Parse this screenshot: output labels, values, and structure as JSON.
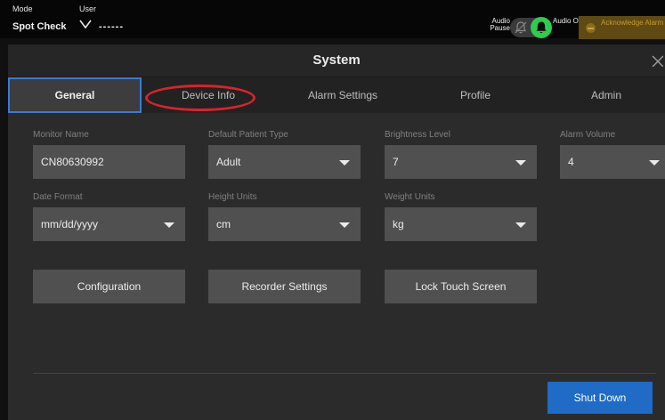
{
  "status_bar": {
    "mode_label": "Mode",
    "mode_value": "Spot Check",
    "user_label": "User",
    "user_value": "------",
    "audio_pause_label": "Audio Pause",
    "audio_on_label": "Audio On",
    "acknowledge_alarm_label": "Acknowledge Alarm",
    "audio_on_color": "#2ecc4f"
  },
  "dialog": {
    "title": "System",
    "tabs": [
      {
        "label": "General",
        "active": true
      },
      {
        "label": "Device Info",
        "active": false
      },
      {
        "label": "Alarm Settings",
        "active": false
      },
      {
        "label": "Profile",
        "active": false
      },
      {
        "label": "Admin",
        "active": false
      }
    ],
    "fields": {
      "monitor_name": {
        "label": "Monitor Name",
        "value": "CN80630992"
      },
      "default_patient_type": {
        "label": "Default Patient Type",
        "value": "Adult"
      },
      "brightness_level": {
        "label": "Brightness Level",
        "value": "7"
      },
      "alarm_volume": {
        "label": "Alarm Volume",
        "value": "4"
      },
      "date_format": {
        "label": "Date Format",
        "value": "mm/dd/yyyy"
      },
      "height_units": {
        "label": "Height Units",
        "value": "cm"
      },
      "weight_units": {
        "label": "Weight Units",
        "value": "kg"
      }
    },
    "buttons": {
      "configuration": "Configuration",
      "recorder_settings": "Recorder Settings",
      "lock_touch_screen": "Lock Touch Screen",
      "shut_down": "Shut Down"
    },
    "highlight_color": "#d9232b",
    "accent_color": "#1f6bc5"
  }
}
